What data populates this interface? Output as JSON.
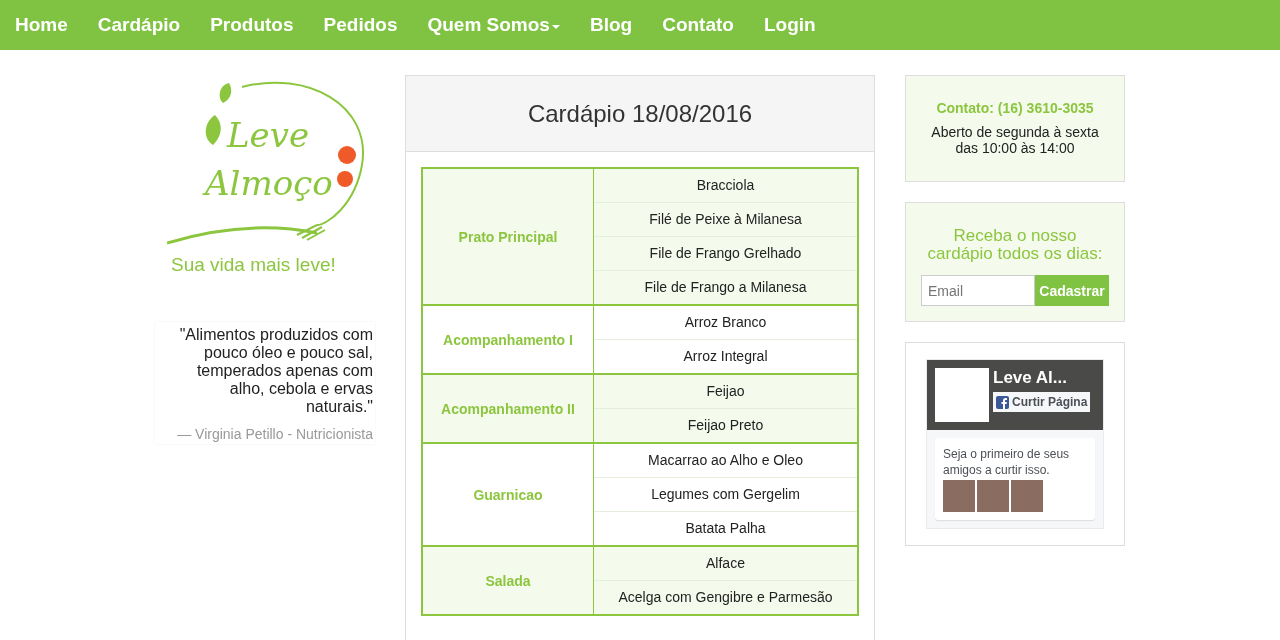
{
  "nav": [
    {
      "label": "Home",
      "dropdown": false
    },
    {
      "label": "Cardápio",
      "dropdown": false
    },
    {
      "label": "Produtos",
      "dropdown": false
    },
    {
      "label": "Pedidos",
      "dropdown": false
    },
    {
      "label": "Quem Somos",
      "dropdown": true
    },
    {
      "label": "Blog",
      "dropdown": false
    },
    {
      "label": "Contato",
      "dropdown": false
    },
    {
      "label": "Login",
      "dropdown": false
    }
  ],
  "logo": {
    "lines": [
      "Leve",
      "Almoço"
    ],
    "tagline": "Sua vida mais leve!"
  },
  "quote": {
    "text": "\"Alimentos produzidos com pouco óleo e pouco sal, temperados apenas com alho, cebola e ervas naturais.\"",
    "author": "— Virginia Petillo - Nutricionista"
  },
  "menu": {
    "title": "Cardápio 18/08/2016",
    "groups": [
      {
        "category": "Prato Principal",
        "items": [
          "Bracciola",
          "Filé de Peixe à Milanesa",
          "File de Frango Grelhado",
          "File de Frango a Milanesa"
        ]
      },
      {
        "category": "Acompanhamento I",
        "items": [
          "Arroz Branco",
          "Arroz Integral"
        ]
      },
      {
        "category": "Acompanhamento II",
        "items": [
          "Feijao",
          "Feijao Preto"
        ]
      },
      {
        "category": "Guarnicao",
        "items": [
          "Macarrao ao Alho e Oleo",
          "Legumes com Gergelim",
          "Batata Palha"
        ]
      },
      {
        "category": "Salada",
        "items": [
          "Alface",
          "Acelga com Gengibre e Parmesão"
        ]
      }
    ]
  },
  "contact": {
    "phone": "Contato: (16) 3610-3035",
    "hours": [
      "Aberto de segunda à sexta",
      "das 10:00 às 14:00"
    ]
  },
  "newsletter": {
    "heading": "Receba o nosso cardápio todos os dias:",
    "placeholder": "Email",
    "button": "Cadastrar"
  },
  "facebook": {
    "page_name": "Leve Al...",
    "like_button": "Curtir Página",
    "text": "Seja o primeiro de seus amigos a curtir isso."
  }
}
